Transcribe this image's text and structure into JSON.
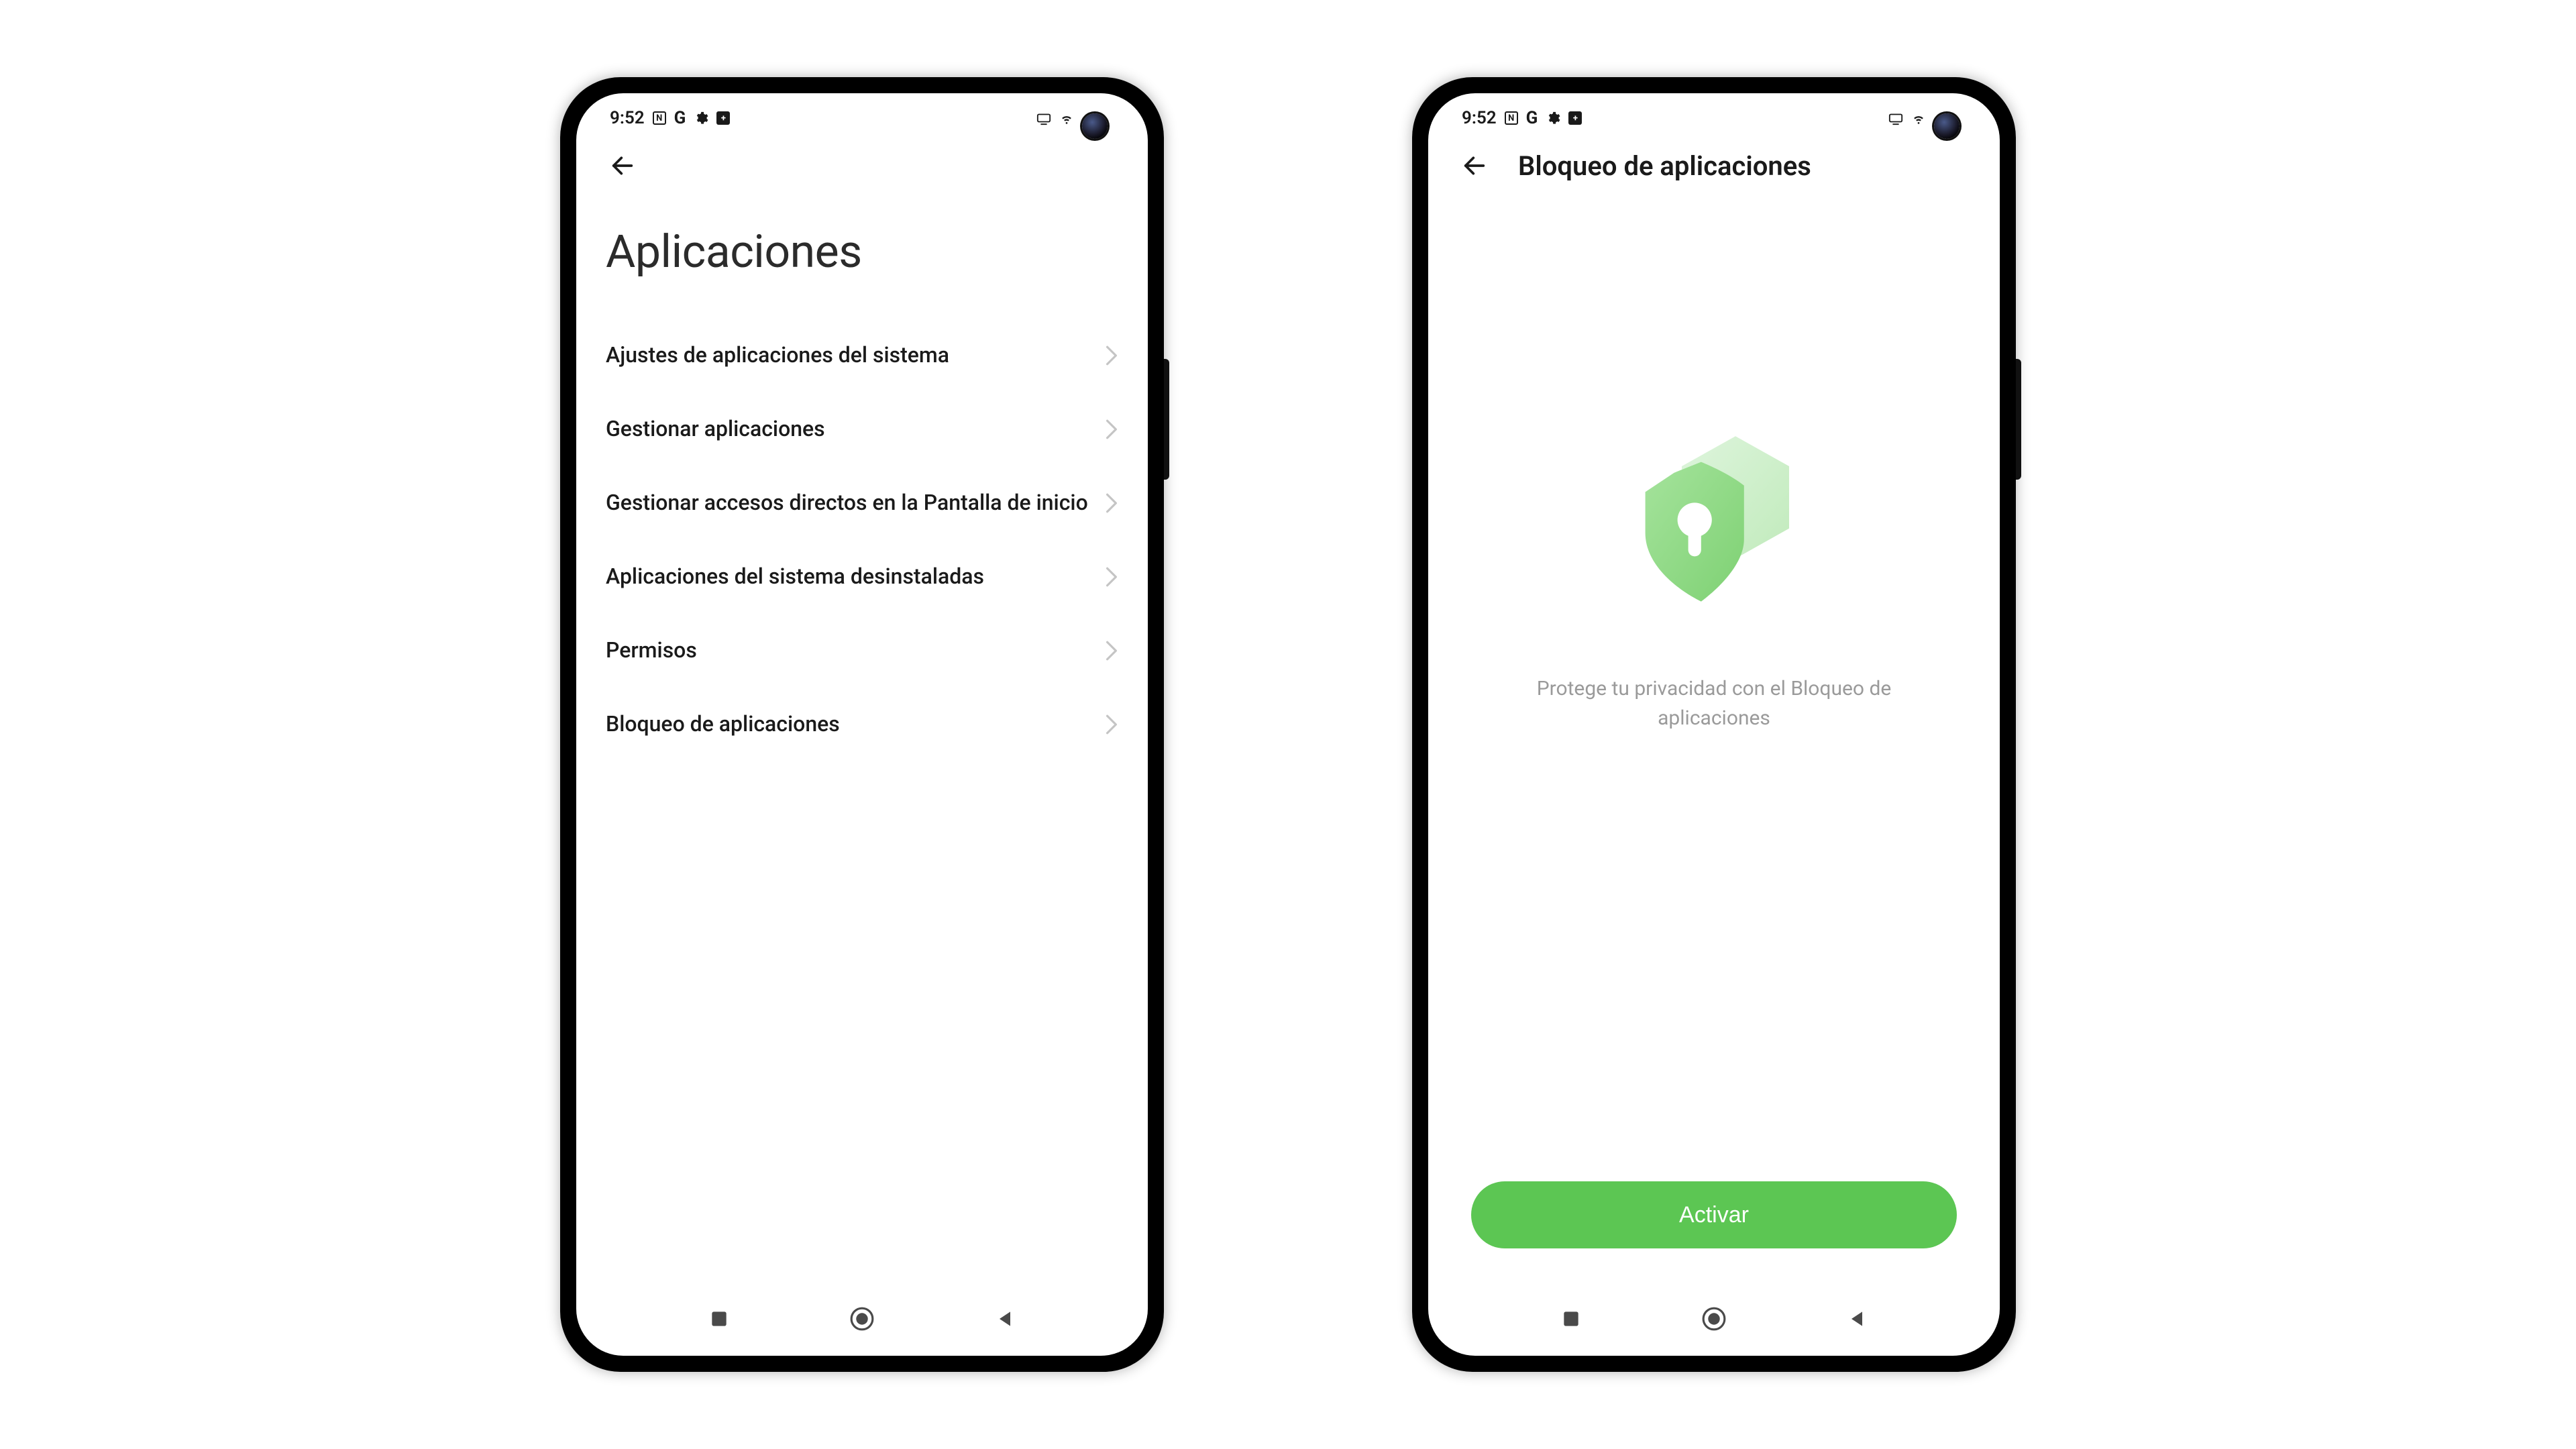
{
  "status": {
    "time": "9:52",
    "left_icon_labels": [
      "nfc",
      "google",
      "gear",
      "battery-saver"
    ],
    "right_icon_labels": [
      "keyboard",
      "wifi",
      "camera"
    ]
  },
  "screen_left": {
    "title": "Aplicaciones",
    "items": [
      {
        "label": "Ajustes de aplicaciones del sistema"
      },
      {
        "label": "Gestionar aplicaciones"
      },
      {
        "label": "Gestionar accesos directos en la Pantalla de inicio"
      },
      {
        "label": "Aplicaciones del sistema desinstaladas"
      },
      {
        "label": "Permisos"
      },
      {
        "label": "Bloqueo de aplicaciones"
      }
    ]
  },
  "screen_right": {
    "header_title": "Bloqueo de aplicaciones",
    "hero_text": "Protege tu privacidad con el Bloqueo de aplicaciones",
    "cta_label": "Activar",
    "accent_color": "#5cc653"
  },
  "nav": {
    "buttons": [
      "recent",
      "home",
      "back"
    ]
  }
}
